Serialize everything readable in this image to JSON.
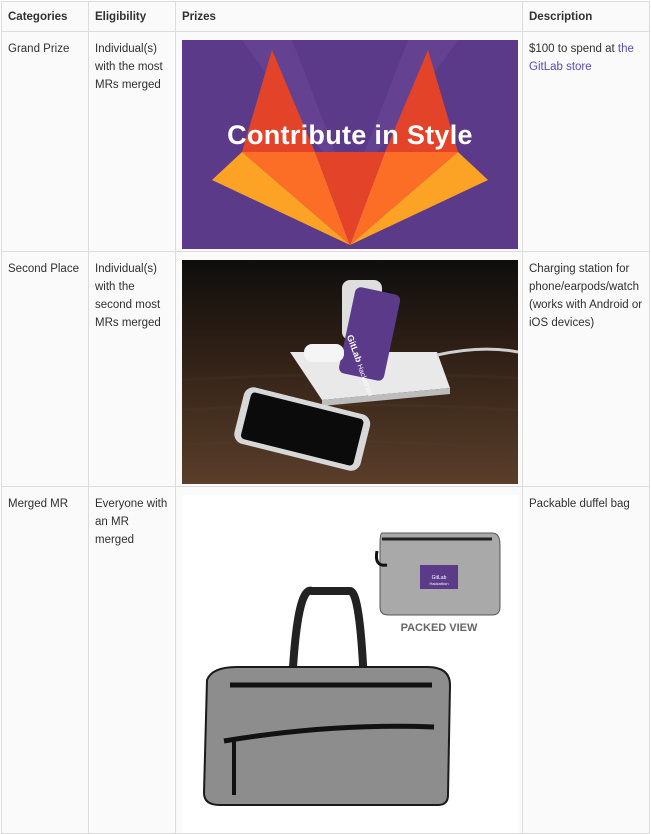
{
  "table": {
    "headers": [
      "Categories",
      "Eligibility",
      "Prizes",
      "Description"
    ],
    "rows": [
      {
        "category": "Grand Prize",
        "eligibility": "Individual(s) with the most MRs merged",
        "prize_image": "contribute-in-style-banner",
        "prize_text": "Contribute in Style",
        "description_prefix": "$100 to spend at ",
        "description_link": "the GitLab store"
      },
      {
        "category": "Second Place",
        "eligibility": "Individual(s) with the second most MRs merged",
        "prize_image": "charging-station-photo",
        "prize_brand": "GitLab",
        "prize_brand_sub": "Hackathon",
        "description": "Charging station for phone/earpods/watch (works with Android or iOS devices)"
      },
      {
        "category": "Merged MR",
        "eligibility": "Everyone with an MR merged",
        "prize_image": "duffel-bag-photo",
        "prize_caption": "PACKED VIEW",
        "prize_brand": "GitLab",
        "prize_brand_sub": "Hackathon",
        "description": "Packable duffel bag"
      }
    ]
  },
  "colors": {
    "link": "#5b4bb3",
    "banner_purple": "#5b3a8a",
    "logo_red": "#e24329",
    "logo_orange": "#fc6d26",
    "logo_yellow": "#fca326"
  }
}
